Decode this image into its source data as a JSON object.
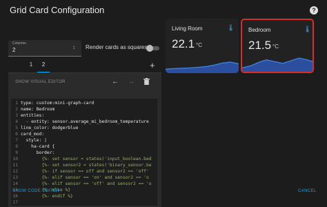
{
  "dialog": {
    "title": "Grid Card Configuration",
    "help_icon": "?"
  },
  "columns_select": {
    "label": "Columns",
    "value": "2",
    "icon": "unfold-icon"
  },
  "square_toggle": {
    "label": "Render cards as squares",
    "checked": false
  },
  "tabs": [
    "1",
    "2"
  ],
  "active_tab": "2",
  "add_icon": "+",
  "editor": {
    "show_visual_editor": "SHOW VISUAL EDITOR",
    "icons": [
      "arrow-left-icon",
      "arrow-right-icon",
      "delete-icon"
    ],
    "lines": [
      {
        "num": "1",
        "text": "type: custom:mini-graph-card",
        "comment": false
      },
      {
        "num": "2",
        "text": "name: Bedroom",
        "comment": false
      },
      {
        "num": "3",
        "text": "entities:",
        "comment": false
      },
      {
        "num": "4",
        "text": "  - entity: sensor.average_mi_bedroom_temperature",
        "comment": false
      },
      {
        "num": "5",
        "text": "line_color: dodgerblue",
        "comment": false
      },
      {
        "num": "6",
        "text": "card_mod:",
        "comment": false
      },
      {
        "num": "7",
        "text": "  style: |",
        "comment": false
      },
      {
        "num": "8",
        "text": "    ha-card {",
        "comment": false
      },
      {
        "num": "9",
        "text": "      border:",
        "comment": false
      },
      {
        "num": "10",
        "text": "        {%- set sensor = states('input_boolean.bed",
        "comment": true
      },
      {
        "num": "11",
        "text": "        {%- set sensor2 = states('binary_sensor.be",
        "comment": true
      },
      {
        "num": "12",
        "text": "        {%- if sensor == off and sensor2 == 'off' ",
        "comment": true
      },
      {
        "num": "13",
        "text": "        {%- elif sensor == 'on' and sensor2 == 'o",
        "comment": true
      },
      {
        "num": "14",
        "text": "        {%- elif sensor == 'off' and sensor2 == 'o",
        "comment": true
      },
      {
        "num": "15",
        "text": "        {%- else %}",
        "comment": true
      },
      {
        "num": "16",
        "text": "        {%- endif %}",
        "comment": true
      },
      {
        "num": "17",
        "text": "",
        "comment": false
      }
    ]
  },
  "footer": {
    "show_code_editor": "SHOW CODE EDITOR",
    "cancel": "CANCEL"
  },
  "preview_cards": [
    {
      "name": "Living Room",
      "value": "22.1",
      "unit": "°C",
      "icon": "thermometer-icon",
      "selected": false,
      "graph": [
        0.15,
        0.18,
        0.2,
        0.22,
        0.25,
        0.3,
        0.38,
        0.5,
        0.55,
        0.45
      ]
    },
    {
      "name": "Bedroom",
      "value": "21.5",
      "unit": "°C",
      "icon": "thermometer-icon",
      "selected": true,
      "graph": [
        0.15,
        0.25,
        0.45,
        0.6,
        0.5,
        0.4,
        0.55,
        0.7,
        0.6,
        0.45
      ]
    }
  ],
  "colors": {
    "accent": "#03a9f4",
    "selected_border": "#db2c2c",
    "graph_fill": "#2b4f9e",
    "graph_line": "#3f7fe0"
  }
}
